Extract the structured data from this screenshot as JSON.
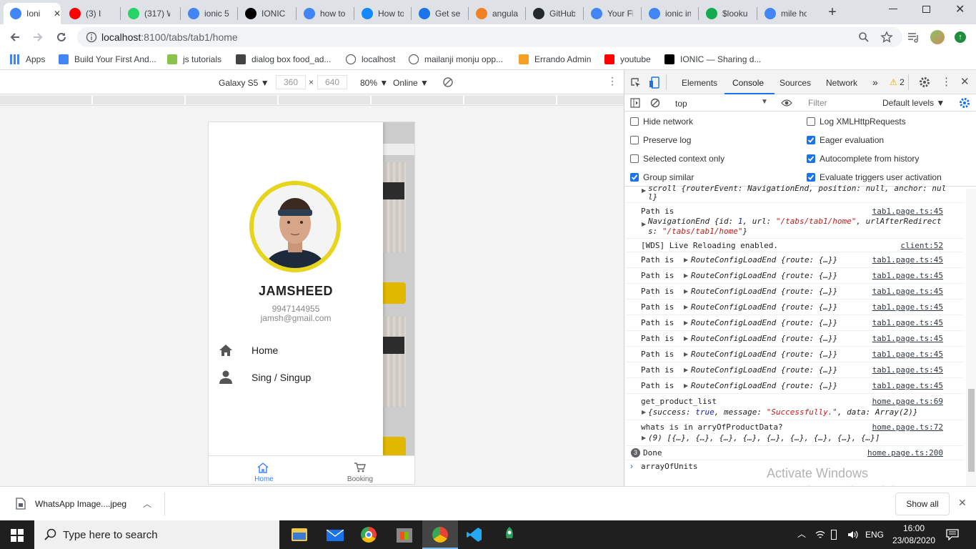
{
  "browser": {
    "tabs": [
      {
        "title": "Ioni",
        "icon": "chrome-circle-icon",
        "color": "#4285f4",
        "active": true
      },
      {
        "title": "(3) I",
        "icon": "youtube-icon",
        "color": "#ff0000"
      },
      {
        "title": "(317) W",
        "icon": "whatsapp-icon",
        "color": "#25d366"
      },
      {
        "title": "ionic 5",
        "icon": "google-icon",
        "color": "#4285f4"
      },
      {
        "title": "IONIC -",
        "icon": "medium-icon",
        "color": "#000000"
      },
      {
        "title": "how to",
        "icon": "google-icon",
        "color": "#4285f4"
      },
      {
        "title": "How to",
        "icon": "stackblitz-icon",
        "color": "#1389fd"
      },
      {
        "title": "Get sele",
        "icon": "chrome-circle-icon",
        "color": "#1a73e8"
      },
      {
        "title": "angular",
        "icon": "stackoverflow-icon",
        "color": "#f48024"
      },
      {
        "title": "GitHub",
        "icon": "github-icon",
        "color": "#24292e"
      },
      {
        "title": "Your Fir",
        "icon": "chrome-circle-icon",
        "color": "#4285f4"
      },
      {
        "title": "ionic in",
        "icon": "google-icon",
        "color": "#4285f4"
      },
      {
        "title": "$lookup",
        "icon": "mongodb-icon",
        "color": "#13aa52"
      },
      {
        "title": "mile ho",
        "icon": "google-icon",
        "color": "#4285f4"
      }
    ],
    "new_tab": "+",
    "url_host": "localhost",
    "url_path": ":8100/tabs/tab1/home",
    "bookmarks": [
      {
        "label": "Apps",
        "icon": "apps-grid-icon"
      },
      {
        "label": "Build Your First And...",
        "icon": "code-bracket-icon"
      },
      {
        "label": "js tutorials",
        "icon": "tutorials-icon"
      },
      {
        "label": "dialog box food_ad...",
        "icon": "diamond-icon"
      },
      {
        "label": "localhost",
        "icon": "globe-icon"
      },
      {
        "label": "mailanji monju opp...",
        "icon": "globe-icon"
      },
      {
        "label": "Errando Admin",
        "icon": "errando-icon"
      },
      {
        "label": "youtube",
        "icon": "youtube-icon"
      },
      {
        "label": "IONIC — Sharing d...",
        "icon": "medium-icon"
      }
    ]
  },
  "device_toolbar": {
    "device": "Galaxy S5",
    "width": "360",
    "times": "×",
    "height": "640",
    "zoom": "80%",
    "network": "Online"
  },
  "app": {
    "user_name": "JAMSHEED",
    "phone": "9947144955",
    "email": "jamsh@gmail.com",
    "menu": [
      {
        "label": "Home",
        "icon": "home-icon"
      },
      {
        "label": "Sing / Singup",
        "icon": "person-icon"
      }
    ],
    "bottom_tabs": [
      {
        "label": "Home",
        "icon": "home-outline-icon",
        "active": true
      },
      {
        "label": "Booking",
        "icon": "cart-outline-icon",
        "active": false
      }
    ],
    "accent_color": "#e6d51c",
    "active_tab_color": "#3880ff"
  },
  "devtools": {
    "tabs": [
      "Elements",
      "Console",
      "Sources",
      "Network"
    ],
    "active_tab": "Console",
    "more": "»",
    "warning_count": "2",
    "context": "top",
    "filter_placeholder": "Filter",
    "levels": "Default levels",
    "settings": [
      {
        "label": "Hide network",
        "checked": false
      },
      {
        "label": "Log XMLHttpRequests",
        "checked": false
      },
      {
        "label": "Preserve log",
        "checked": false
      },
      {
        "label": "Eager evaluation",
        "checked": true
      },
      {
        "label": "Selected context only",
        "checked": false
      },
      {
        "label": "Autocomplete from history",
        "checked": true
      },
      {
        "label": "Group similar",
        "checked": true
      },
      {
        "label": "Evaluate triggers user activation",
        "checked": true
      }
    ],
    "logs": {
      "partial_top_1": "scroll {routerEvent: NavigationEnd, position: null, anchor: nul",
      "partial_top_2": "l}",
      "path_is": "Path is",
      "nav_end_1": "NavigationEnd {id: 1, url: \"/tabs/tab1/home\", urlAfterRedirect",
      "nav_end_2": "s: \"/tabs/tab1/home\"}",
      "tab1_src": "tab1.page.ts:45",
      "wds": "[WDS] Live Reloading enabled.",
      "client_src": "client:52",
      "route_config": "RouteConfigLoadEnd {route: {…}}",
      "product_list": "get_product_list",
      "product_list_src": "home.page.ts:69",
      "product_obj": "{success: true, message: \"Successfully.\", data: Array(2)}",
      "arry_title": "whats is in arryOfProductData?",
      "arry_src": "home.page.ts:72",
      "arry_val": "(9) [{…}, {…}, {…}, {…}, {…}, {…}, {…}, {…}, {…}]",
      "done_count": "3",
      "done": "Done",
      "done_src": "home.page.ts:200",
      "prompt": "arrayOfUnits"
    },
    "watermark_1": "Activate Windows",
    "watermark_2": "Go to Settings to activate Windows."
  },
  "downloads": {
    "file": "WhatsApp Image....jpeg",
    "show_all": "Show all"
  },
  "taskbar": {
    "search_placeholder": "Type here to search",
    "lang": "ENG",
    "time": "16:00",
    "date": "23/08/2020"
  }
}
